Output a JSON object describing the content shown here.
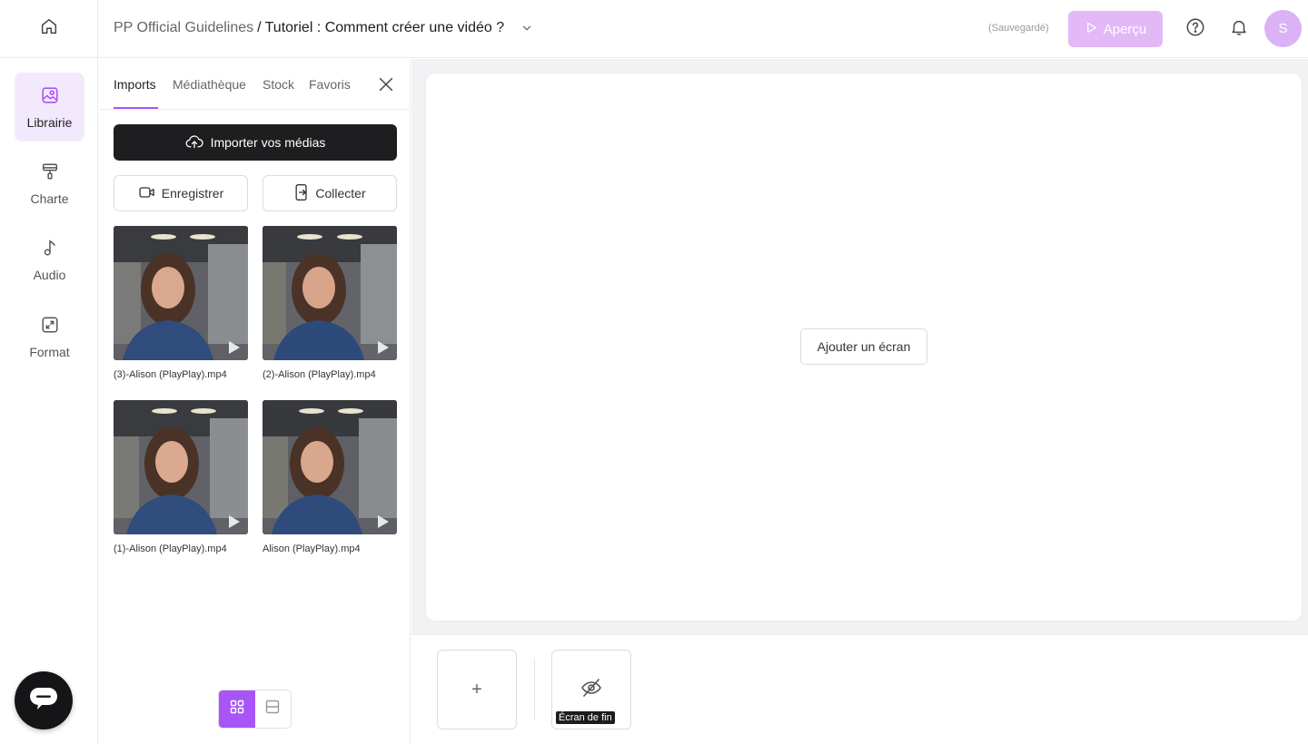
{
  "header": {
    "project": "PP Official Guidelines",
    "separator": "/",
    "video_title": "Tutoriel : Comment créer une vidéo ?",
    "save_status": "(Sauvegardé)",
    "preview_label": "Aperçu",
    "avatar_initial": "S"
  },
  "rail": {
    "items": [
      {
        "label": "Librairie",
        "icon": "library-icon"
      },
      {
        "label": "Charte",
        "icon": "paint-roller-icon"
      },
      {
        "label": "Audio",
        "icon": "music-note-icon"
      },
      {
        "label": "Format",
        "icon": "resize-icon"
      }
    ]
  },
  "library": {
    "tabs": [
      "Imports",
      "Médiathèque",
      "Stock",
      "Favoris"
    ],
    "active_tab": "Imports",
    "import_label": "Importer vos médias",
    "record_label": "Enregistrer",
    "collect_label": "Collecter",
    "media": [
      {
        "name": "(3)-Alison (PlayPlay).mp4"
      },
      {
        "name": "(2)-Alison (PlayPlay).mp4"
      },
      {
        "name": "(1)-Alison (PlayPlay).mp4"
      },
      {
        "name": "Alison (PlayPlay).mp4"
      }
    ]
  },
  "editor": {
    "add_screen_label": "Ajouter un écran",
    "add_symbol": "+",
    "end_screen_label": "Écran de fin"
  },
  "colors": {
    "accent": "#a855f7",
    "preview_button": "#e3b8f7",
    "avatar": "#dcb2f6",
    "active_rail": "#f3e9fd"
  }
}
